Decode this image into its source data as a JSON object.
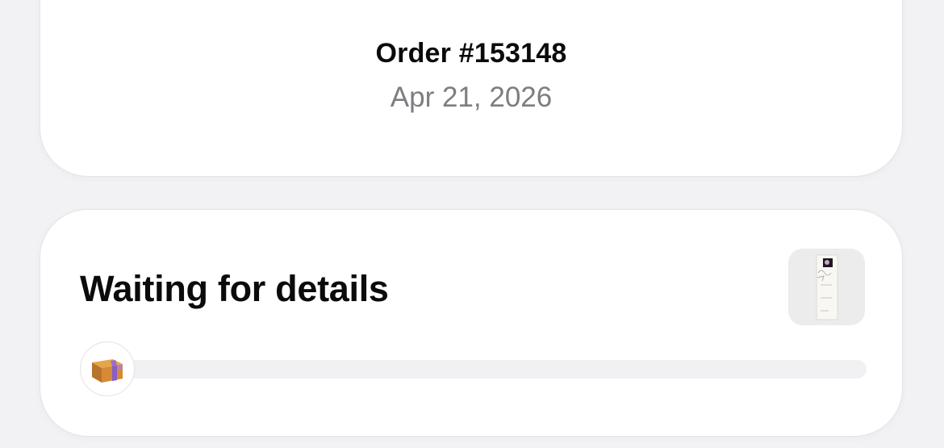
{
  "order": {
    "number_label": "Order #153148",
    "date": "Apr 21, 2026"
  },
  "status": {
    "title": "Waiting for details",
    "progress_fraction": 0.0,
    "stage_icon": "package-box-icon",
    "product_thumbnail": "product-thumbnail"
  },
  "colors": {
    "background": "#f2f2f4",
    "card": "#ffffff",
    "text_primary": "#0b0b0b",
    "text_secondary": "#7d7d82",
    "track": "#f1f1f4",
    "box_accent": "#9b6cd6"
  }
}
